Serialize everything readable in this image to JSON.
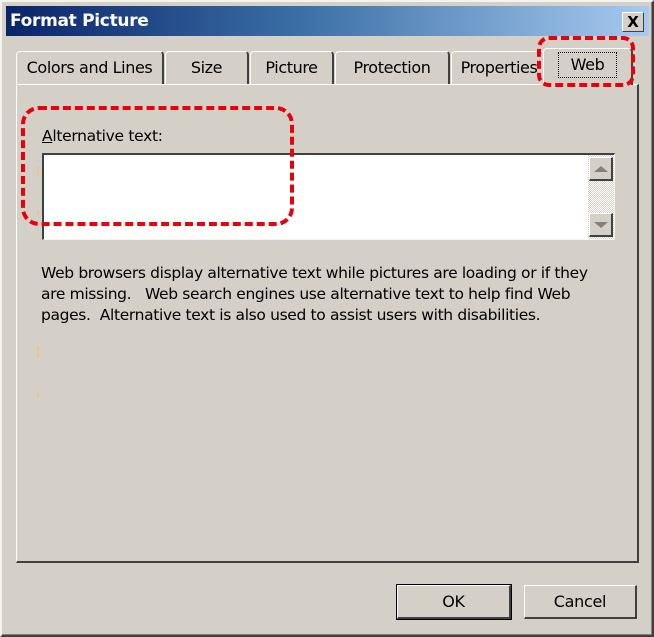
{
  "window": {
    "title": "Format Picture",
    "close_label": "X"
  },
  "tabs": [
    {
      "label": "Colors and Lines",
      "selected": false
    },
    {
      "label": "Size",
      "selected": false
    },
    {
      "label": "Picture",
      "selected": false
    },
    {
      "label": "Protection",
      "selected": false
    },
    {
      "label": "Properties",
      "selected": false
    },
    {
      "label": "Web",
      "selected": true
    }
  ],
  "web_panel": {
    "alt_text_label_accel": "A",
    "alt_text_label_rest": "lternative text:",
    "alt_text_value": "",
    "description": "Web browsers display alternative text while pictures are loading or if they\nare missing.   Web search engines use alternative text to help find Web\npages.  Alternative text is also used to assist users with disabilities."
  },
  "buttons": {
    "ok": "OK",
    "cancel": "Cancel"
  },
  "annotations": {
    "color": "#e8000b",
    "highlighted": [
      "Web tab",
      "Alternative text field"
    ]
  }
}
